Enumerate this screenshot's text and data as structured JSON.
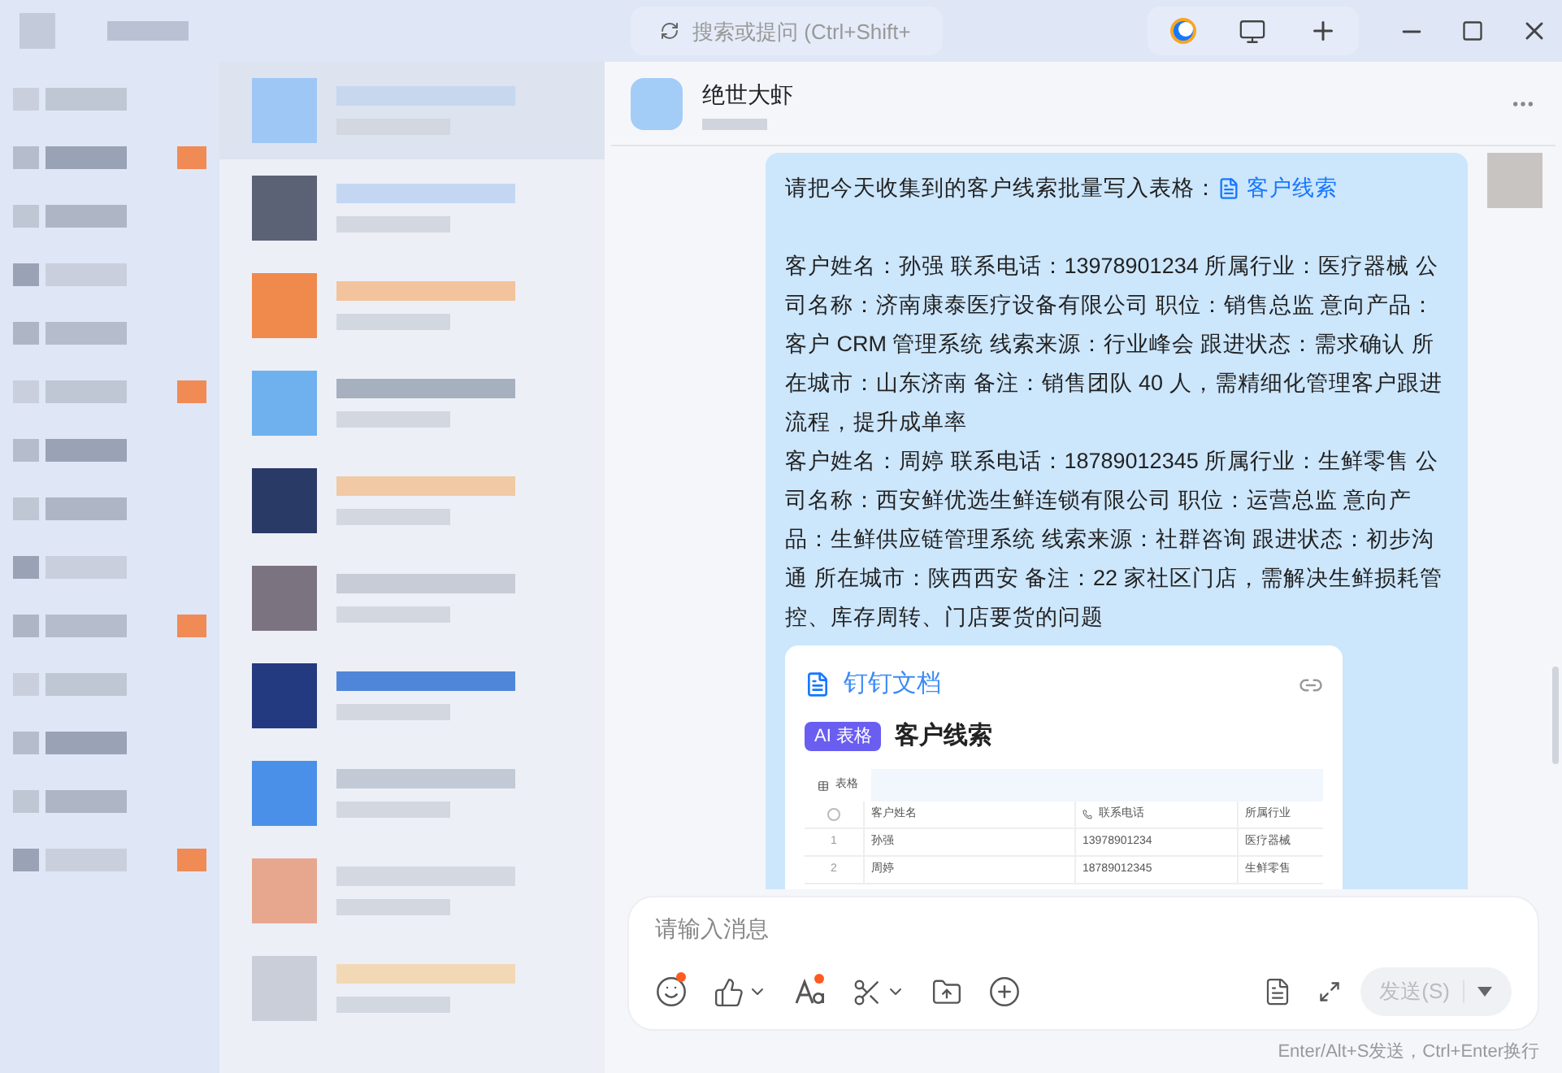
{
  "search": {
    "placeholder": "搜索或提问 (Ctrl+Shift+"
  },
  "chat": {
    "title": "绝世大虾"
  },
  "message": {
    "intro": "请把今天收集到的客户线索批量写入表格：",
    "doc_link": "客户线索",
    "paragraphs": [
      "客户姓名：孙强 联系电话：13978901234 所属行业：医疗器械 公司名称：济南康泰医疗设备有限公司 职位：销售总监 意向产品：客户 CRM 管理系统 线索来源：行业峰会 跟进状态：需求确认 所在城市：山东济南 备注：销售团队 40 人，需精细化管理客户跟进流程，提升成单率",
      "客户姓名：周婷 联系电话：18789012345 所属行业：生鲜零售 公司名称：西安鲜优选生鲜连锁有限公司 职位：运营总监 意向产品：生鲜供应链管理系统 线索来源：社群咨询 跟进状态：初步沟通 所在城市：陕西西安 备注：22 家社区门店，需解决生鲜损耗管控、库存周转、门店要货的问题"
    ]
  },
  "card": {
    "source": "钉钉文档",
    "badge": "AI 表格",
    "title": "客户线索",
    "tab": "表格",
    "select_all_checked": false,
    "columns": [
      "客户姓名",
      "联系电话",
      "所属行业"
    ],
    "rows": [
      {
        "index": "1",
        "cells": [
          "孙强",
          "13978901234",
          "医疗器械"
        ]
      },
      {
        "index": "2",
        "cells": [
          "周婷",
          "18789012345",
          "生鲜零售"
        ]
      }
    ]
  },
  "composer": {
    "placeholder": "请输入消息",
    "tools": [
      {
        "kind": "emoji",
        "dot": true,
        "menu": false
      },
      {
        "kind": "like",
        "dot": false,
        "menu": true
      },
      {
        "kind": "font",
        "dot": true,
        "menu": false
      },
      {
        "kind": "scissors",
        "dot": false,
        "menu": true
      },
      {
        "kind": "upload",
        "dot": false,
        "menu": false
      },
      {
        "kind": "plus",
        "dot": false,
        "menu": false
      }
    ],
    "send": {
      "label": "发送(S)",
      "disabled": true
    },
    "hint": "Enter/Alt+S发送，Ctrl+Enter换行"
  }
}
